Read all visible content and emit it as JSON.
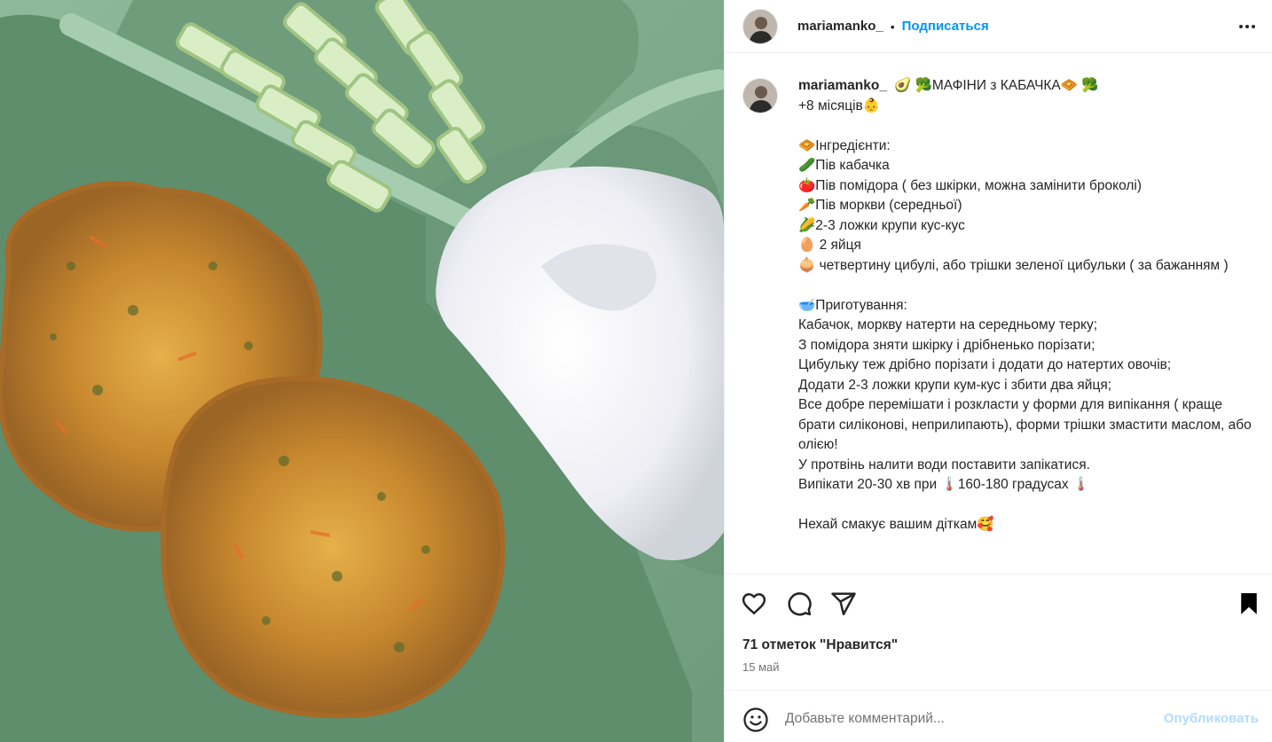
{
  "post": {
    "username": "mariamanko_",
    "header_dot": "•",
    "follow_label": "Подписаться",
    "caption": "🥑 🥦МАФІНИ з КАБАЧКА🧇 🥦\n+8 місяців👶\n\n🧇Інгредієнти:\n🥒Пів кабачка\n🍅Пів помідора ( без шкірки, можна замінити броколі)\n🥕Пів моркви (середньої)\n🌽2-3 ложки крупи кус-кус\n🥚 2 яйця\n🧅 четвертину цибулі, або трішки зеленої цибульки ( за бажанням )\n\n🥣Приготування:\nКабачок, моркву натерти на середньому терку;\nЗ помідора зняти шкірку і дрібненько порізати;\nЦибульку теж дрібно порізати і додати до натертих овочів;\nДодати 2-3 ложки крупи кум-кус і збити два яйця;\nВсе добре перемішати і розкласти у форми для випікання ( краще брати силіконові, неприлипають), форми трішки змастити маслом, або олією!\nУ протвінь налити води поставити запікатися.\nВипікати 20-30 хв при 🌡️160-180 градусах 🌡️\n\nНехай смакує вашим діткам🥰",
    "likes_text": "71 отметок \"Нравится\"",
    "date": "15 май"
  },
  "comment": {
    "placeholder": "Добавьте комментарий...",
    "post_label": "Опубликовать"
  },
  "icons": {
    "like": "heart-icon",
    "comment": "comment-bubble-icon",
    "share": "paper-plane-icon",
    "save": "bookmark-icon",
    "more": "more-options-icon",
    "emoji": "emoji-smile-icon"
  },
  "colors": {
    "link_blue": "#0095f6",
    "post_disabled": "#b3dbff",
    "text": "#262626",
    "muted": "#737373"
  }
}
